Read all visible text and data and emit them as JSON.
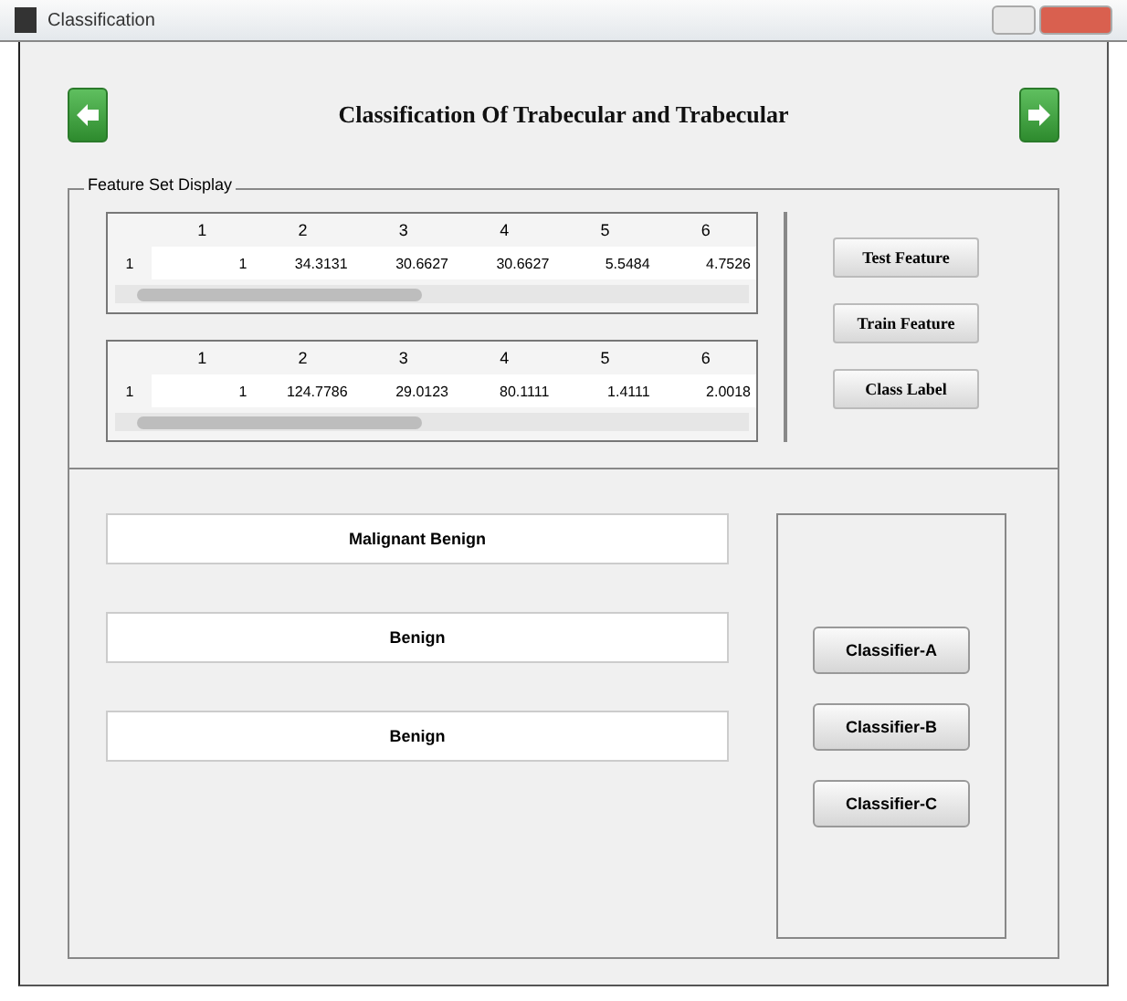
{
  "window": {
    "title": "Classification"
  },
  "header": {
    "title": "Classification Of Trabecular and Trabecular"
  },
  "panel": {
    "label": "Feature Set Display"
  },
  "tables": [
    {
      "columns": [
        "1",
        "2",
        "3",
        "4",
        "5",
        "6"
      ],
      "rows": [
        {
          "label": "1",
          "cells": [
            "1",
            "34.3131",
            "30.6627",
            "30.6627",
            "5.5484",
            "4.7526"
          ]
        }
      ]
    },
    {
      "columns": [
        "1",
        "2",
        "3",
        "4",
        "5",
        "6"
      ],
      "rows": [
        {
          "label": "1",
          "cells": [
            "1",
            "124.7786",
            "29.0123",
            "80.1111",
            "1.4111",
            "2.0018"
          ]
        }
      ]
    }
  ],
  "feature_buttons": [
    "Test Feature",
    "Train Feature",
    "Class Label"
  ],
  "results": [
    "Malignant Benign",
    "Benign",
    "Benign"
  ],
  "classifier_buttons": [
    "Classifier-A",
    "Classifier-B",
    "Classifier-C"
  ]
}
